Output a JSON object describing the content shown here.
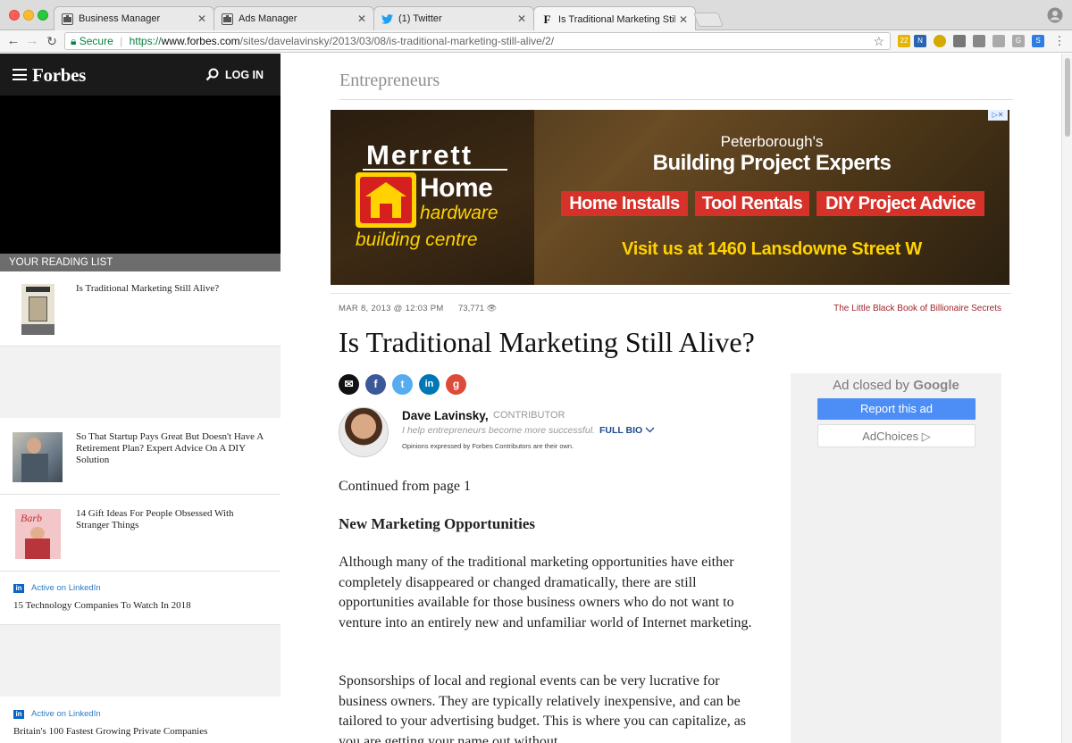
{
  "browser": {
    "tabs": [
      {
        "label": "Business Manager",
        "icon": "business-manager-icon"
      },
      {
        "label": "Ads Manager",
        "icon": "ads-manager-icon"
      },
      {
        "label": "(1) Twitter",
        "icon": "twitter-icon"
      },
      {
        "label": "Is Traditional Marketing Still Al",
        "icon": "forbes-favicon",
        "active": true
      }
    ],
    "close_glyph": "✕",
    "url": {
      "secure_label": "Secure",
      "scheme": "https://",
      "host": "www.forbes.com",
      "path": "/sites/davelavinsky/2013/03/08/is-traditional-marketing-still-alive/2/"
    }
  },
  "sidebar": {
    "logo": "Forbes",
    "login_label": "LOG IN",
    "reading_list_label": "YOUR READING LIST",
    "items": [
      {
        "title": "Is Traditional Marketing Still Alive?"
      },
      {
        "title": "So That Startup Pays Great But Doesn't Have A Retirement Plan? Expert Advice On A DIY Solution"
      },
      {
        "title": "14 Gift Ideas For People Obsessed With Stranger Things"
      },
      {
        "source": "Active on LinkedIn",
        "title": "15 Technology Companies To Watch In 2018"
      },
      {
        "source": "Active on LinkedIn",
        "title": "Britain's 100 Fastest Growing Private Companies"
      }
    ],
    "linkedin_badge": "in"
  },
  "article": {
    "channel": "Entrepreneurs",
    "date": "MAR 8, 2013 @ 12:03 PM",
    "views": "73,771",
    "promo_link": "The Little Black Book of Billionaire Secrets",
    "headline": "Is Traditional Marketing Still Alive?",
    "share_buttons": [
      {
        "name": "email",
        "glyph": "✉",
        "color": "#111111"
      },
      {
        "name": "facebook",
        "glyph": "f",
        "color": "#3b5998"
      },
      {
        "name": "twitter",
        "glyph": "t",
        "color": "#55acee"
      },
      {
        "name": "linkedin",
        "glyph": "in",
        "color": "#0077b5"
      },
      {
        "name": "google-plus",
        "glyph": "g",
        "color": "#dd4b39"
      }
    ],
    "author": {
      "name": "Dave Lavinsky",
      "role": "CONTRIBUTOR",
      "tagline": "I help entrepreneurs become more successful.",
      "full_bio_label": "FULL BIO",
      "disclaimer": "Opinions expressed by Forbes Contributors are their own."
    },
    "body": {
      "continued": "Continued from page 1",
      "subheading": "New Marketing Opportunities",
      "paragraph1": "Although many of the traditional marketing opportunities have either completely disappeared or changed dramatically, there are still opportunities available for those business owners who do not want to venture into an entirely new and unfamiliar world of Internet marketing.",
      "paragraph2": "Sponsorships of local and regional events can be very lucrative for business owners. They are typically relatively inexpensive, and can be tailored to your advertising budget. This is where you can capitalize, as you are getting your name out without"
    }
  },
  "banner_ad": {
    "brand_top": "Merrett",
    "brand_home": "Home",
    "brand_hardware": "hardware",
    "brand_building": "building centre",
    "tagline_small": "Peterborough's",
    "tagline_large": "Building Project Experts",
    "services": [
      "Home Installs",
      "Tool Rentals",
      "DIY Project Advice"
    ],
    "visit": "Visit us at 1460 Lansdowne Street W",
    "adchoice_glyph": "▷✕"
  },
  "ad_panel": {
    "closed_by": "Ad closed by",
    "provider": "Google",
    "report_label": "Report this ad",
    "adchoices_label": "AdChoices ▷"
  },
  "colors": {
    "forbes_header": "#1a1a1a",
    "reading_list_bar": "#6d6d6d",
    "promo_link": "#a1262e",
    "report_button": "#4d8ef6",
    "ad_red": "#d6322a",
    "ad_yellow": "#ffd200"
  }
}
